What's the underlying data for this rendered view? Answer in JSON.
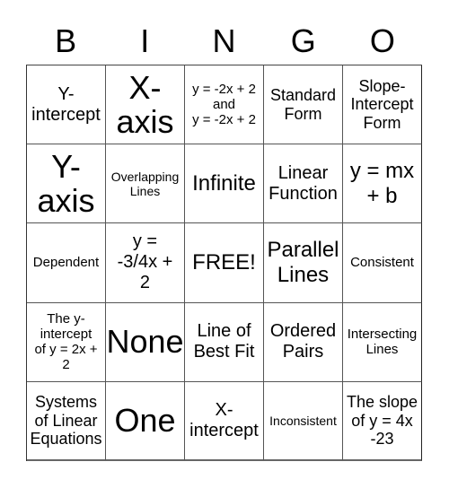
{
  "header": {
    "letters": [
      "B",
      "I",
      "N",
      "G",
      "O"
    ]
  },
  "board": {
    "cells": [
      "Y-\nintercept",
      "X-\naxis",
      "y = -2x + 2\nand\ny = -2x + 2",
      "Standard\nForm",
      "Slope-\nIntercept\nForm",
      "Y-\naxis",
      "Overlapping\nLines",
      "Infinite",
      "Linear\nFunction",
      "y = mx\n+ b",
      "Dependent",
      "y =\n-3/4x +\n2",
      "FREE!",
      "Parallel\nLines",
      "Consistent",
      "The y-\nintercept\nof y = 2x +\n2",
      "None",
      "Line of\nBest Fit",
      "Ordered\nPairs",
      "Intersecting\nLines",
      "Systems\nof Linear\nEquations",
      "One",
      "X-\nintercept",
      "Inconsistent",
      "The slope\nof y = 4x\n-23"
    ]
  }
}
